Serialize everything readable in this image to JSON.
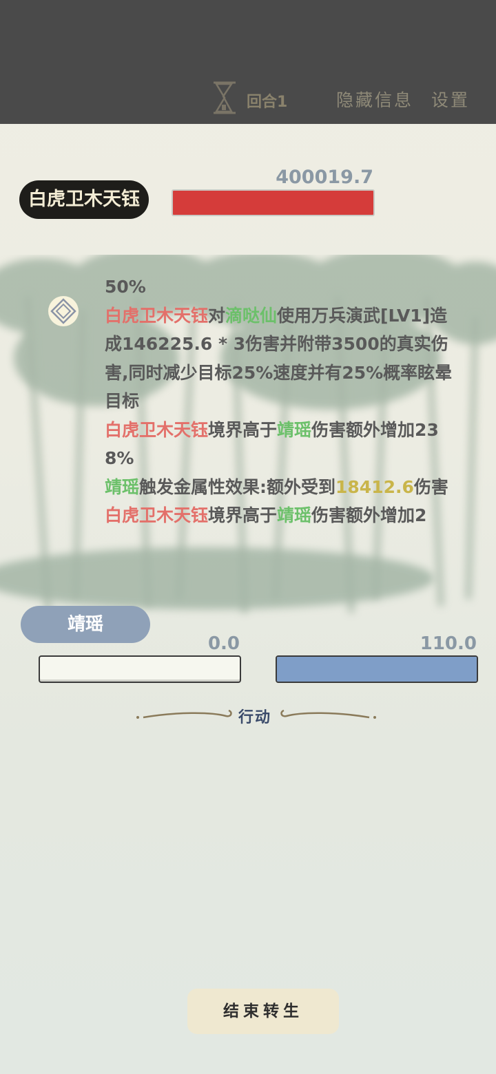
{
  "topbar": {
    "round_label": "回合1",
    "hide_info_label": "隐藏信息",
    "settings_label": "设置"
  },
  "enemy": {
    "name": "白虎卫木天钰",
    "hp_value": "400019.7",
    "hp_fill_fraction": 1.0,
    "hp_color": "#d53c3a"
  },
  "log": {
    "icon": "diamond-icon",
    "line0": "50%",
    "entry1": {
      "actor": "白虎卫木天钰",
      "t1": "对",
      "target": "滴哒仙",
      "t2": "使用万兵演武[LV1]造成146225.6 * 3伤害并附带3500的真实伤害,同时减少目标25%速度并有25%概率眩晕目标"
    },
    "entry2": {
      "actor": "白虎卫木天钰",
      "t1": "境界高于",
      "target": "靖瑶",
      "t2": "伤害额外增加238%"
    },
    "entry3": {
      "actor": "靖瑶",
      "t1": "触发金属性效果:额外受到",
      "value": "18412.6",
      "t2": "伤害"
    },
    "entry4": {
      "actor": "白虎卫木天钰",
      "t1": "境界高于",
      "target": "靖瑶",
      "t2": "伤害额外增加2"
    }
  },
  "player": {
    "name": "靖瑶",
    "hp_value": "0.0",
    "hp_fill_fraction": 0.0,
    "mp_value": "110.0",
    "mp_fill_fraction": 1.0,
    "mp_color": "#7f9ec8"
  },
  "action": {
    "label": "行动"
  },
  "end_button": {
    "label": "结束转生"
  }
}
